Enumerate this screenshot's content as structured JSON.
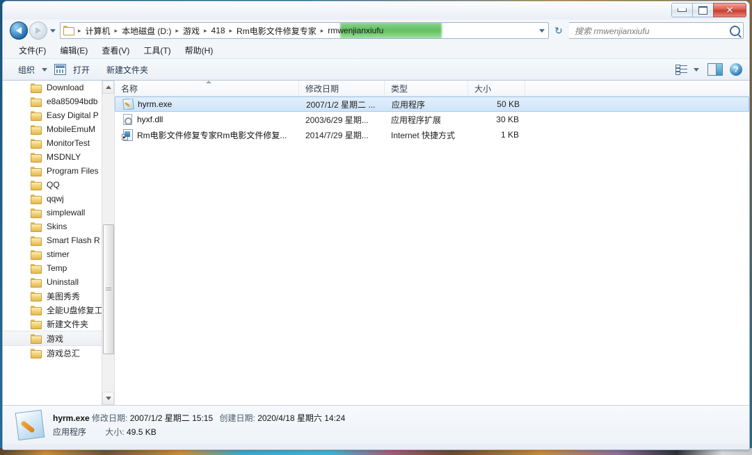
{
  "window": {
    "controls": {
      "minimize": "最小化",
      "maximize": "最大化",
      "close": "✕"
    }
  },
  "address": {
    "back_tooltip": "后退",
    "forward_tooltip": "前进",
    "breadcrumbs": [
      "计算机",
      "本地磁盘 (D:)",
      "游戏",
      "418",
      "Rm电影文件修复专家",
      "rmwenjianxiufu"
    ],
    "separator": "▸",
    "refresh_glyph": "↻",
    "highlight_color": "#46b446"
  },
  "search": {
    "placeholder": "搜索 rmwenjianxiufu"
  },
  "menu": {
    "items": [
      "文件(F)",
      "编辑(E)",
      "查看(V)",
      "工具(T)",
      "帮助(H)"
    ]
  },
  "toolbar": {
    "organize_label": "组织",
    "open_label": "打开",
    "new_folder_label": "新建文件夹",
    "help_glyph": "?"
  },
  "navpane": {
    "items": [
      {
        "label": "Download",
        "selected": false
      },
      {
        "label": "e8a85094bdb",
        "selected": false
      },
      {
        "label": "Easy Digital P",
        "selected": false
      },
      {
        "label": "MobileEmuM",
        "selected": false
      },
      {
        "label": "MonitorTest",
        "selected": false
      },
      {
        "label": "MSDNLY",
        "selected": false
      },
      {
        "label": "Program Files",
        "selected": false
      },
      {
        "label": "QQ",
        "selected": false
      },
      {
        "label": "qqwj",
        "selected": false
      },
      {
        "label": "simplewall",
        "selected": false
      },
      {
        "label": "Skins",
        "selected": false
      },
      {
        "label": "Smart Flash R",
        "selected": false
      },
      {
        "label": "stimer",
        "selected": false
      },
      {
        "label": "Temp",
        "selected": false
      },
      {
        "label": "Uninstall",
        "selected": false
      },
      {
        "label": "美图秀秀",
        "selected": false
      },
      {
        "label": "全能U盘修复工",
        "selected": false
      },
      {
        "label": "新建文件夹",
        "selected": false
      },
      {
        "label": "游戏",
        "selected": true
      },
      {
        "label": "游戏总汇",
        "selected": false
      }
    ]
  },
  "filelist": {
    "columns": [
      "名称",
      "修改日期",
      "类型",
      "大小"
    ],
    "sort_column": "名称",
    "sort_direction": "ascending",
    "rows": [
      {
        "name": "hyrm.exe",
        "date": "2007/1/2 星期二 ...",
        "type": "应用程序",
        "size": "50 KB",
        "icon": "exe-icon",
        "selected": true
      },
      {
        "name": "hyxf.dll",
        "date": "2003/6/29 星期...",
        "type": "应用程序扩展",
        "size": "30 KB",
        "icon": "dll-icon",
        "selected": false
      },
      {
        "name": "Rm电影文件修复专家Rm电影文件修复...",
        "date": "2014/7/29 星期...",
        "type": "Internet 快捷方式",
        "size": "1 KB",
        "icon": "url-shortcut-icon",
        "selected": false
      }
    ]
  },
  "details": {
    "filename": "hyrm.exe",
    "modified_key": "修改日期:",
    "modified_value": "2007/1/2 星期二 15:15",
    "created_key": "创建日期:",
    "created_value": "2020/4/18 星期六 14:24",
    "type_value": "应用程序",
    "size_key": "大小:",
    "size_value": "49.5 KB"
  }
}
